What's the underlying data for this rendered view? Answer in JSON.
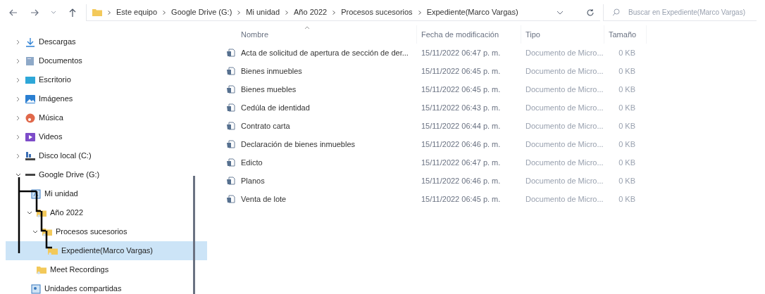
{
  "address_bar": {
    "path": [
      "Este equipo",
      "Google Drive (G:)",
      "Mi unidad",
      "Año 2022",
      "Procesos sucesorios",
      "Expediente(Marco Vargas)"
    ]
  },
  "search": {
    "placeholder": "Buscar en Expediente(Marco Vargas)"
  },
  "sidebar": {
    "items": [
      {
        "label": "Descargas",
        "kind": "download",
        "expanded": false,
        "selected": false
      },
      {
        "label": "Documentos",
        "kind": "documents",
        "expanded": false,
        "selected": false
      },
      {
        "label": "Escritorio",
        "kind": "desktop",
        "expanded": false,
        "selected": false
      },
      {
        "label": "Imágenes",
        "kind": "pictures",
        "expanded": false,
        "selected": false
      },
      {
        "label": "Música",
        "kind": "music",
        "expanded": false,
        "selected": false
      },
      {
        "label": "Videos",
        "kind": "videos",
        "expanded": false,
        "selected": false
      },
      {
        "label": "Disco local (C:)",
        "kind": "disk",
        "expanded": false,
        "selected": false
      },
      {
        "label": "Google Drive (G:)",
        "kind": "drive",
        "expanded": true,
        "selected": false,
        "children": [
          {
            "label": "Mi unidad",
            "kind": "mydrive",
            "selected": false,
            "children": [
              {
                "label": "Año 2022",
                "kind": "folder",
                "expanded": true,
                "selected": false,
                "children": [
                  {
                    "label": "Procesos sucesorios",
                    "kind": "folder",
                    "expanded": true,
                    "selected": false,
                    "children": [
                      {
                        "label": "Expediente(Marco Vargas)",
                        "kind": "folder",
                        "selected": true
                      }
                    ]
                  }
                ]
              },
              {
                "label": "Meet Recordings",
                "kind": "folder",
                "selected": false
              }
            ]
          },
          {
            "label": "Unidades compartidas",
            "kind": "shared",
            "selected": false
          }
        ]
      }
    ]
  },
  "table": {
    "columns": [
      "Nombre",
      "Fecha de modificación",
      "Tipo",
      "Tamaño"
    ],
    "rows": [
      [
        "Acta de solicitud de apertura de sección de der...",
        "15/11/2022 06:47 p. m.",
        "Documento de Micro...",
        "0 KB"
      ],
      [
        "Bienes inmuebles",
        "15/11/2022 06:45 p. m.",
        "Documento de Micro...",
        "0 KB"
      ],
      [
        "Bienes muebles",
        "15/11/2022 06:45 p. m.",
        "Documento de Micro...",
        "0 KB"
      ],
      [
        "Cedúla de identidad",
        "15/11/2022 06:43 p. m.",
        "Documento de Micro...",
        "0 KB"
      ],
      [
        "Contrato carta",
        "15/11/2022 06:44 p. m.",
        "Documento de Micro...",
        "0 KB"
      ],
      [
        "Declaración de bienes inmuebles",
        "15/11/2022 06:46 p. m.",
        "Documento de Micro...",
        "0 KB"
      ],
      [
        "Edicto",
        "15/11/2022 06:47 p. m.",
        "Documento de Micro...",
        "0 KB"
      ],
      [
        "Planos",
        "15/11/2022 06:46 p. m.",
        "Documento de Micro...",
        "0 KB"
      ],
      [
        "Venta de lote",
        "15/11/2022 06:45 p. m.",
        "Documento de Micro...",
        "0 KB"
      ]
    ]
  }
}
